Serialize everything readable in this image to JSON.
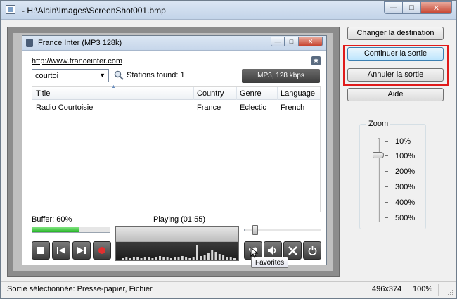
{
  "window": {
    "title": "- H:\\Alain\\Images\\ScreenShot001.bmp"
  },
  "captured": {
    "title": "France Inter (MP3 128k)",
    "url": "http://www.franceinter.com",
    "search_value": "courtoi",
    "stations_found": "Stations found: 1",
    "format": "MP3, 128 kbps",
    "table": {
      "headers": [
        "Title",
        "Country",
        "Genre",
        "Language"
      ],
      "rows": [
        [
          "Radio Courtoisie",
          "France",
          "Eclectic",
          "French"
        ]
      ]
    },
    "buffer_label": "Buffer: 60%",
    "buffer_percent": 60,
    "playing_label": "Playing (01:55)",
    "volume_fraction": 0.12,
    "tooltip": "Favorites",
    "controls": [
      "stop-icon",
      "previous-icon",
      "next-icon",
      "record-icon",
      "favorites-icon",
      "volume-icon",
      "tools-icon",
      "power-icon"
    ]
  },
  "actions": {
    "change_destination": "Changer la destination",
    "continue_output": "Continuer la sortie",
    "cancel_output": "Annuler la sortie",
    "help": "Aide"
  },
  "zoom": {
    "label": "Zoom",
    "options": [
      "10%",
      "100%",
      "200%",
      "300%",
      "400%",
      "500%"
    ],
    "selected": "100%"
  },
  "status": {
    "output": "Sortie sélectionnée:  Presse-papier, Fichier",
    "dimensions": "496x374",
    "zoom": "100%"
  },
  "colors": {
    "highlight": "#e01a1a",
    "buffer_fill": "#28b428"
  }
}
